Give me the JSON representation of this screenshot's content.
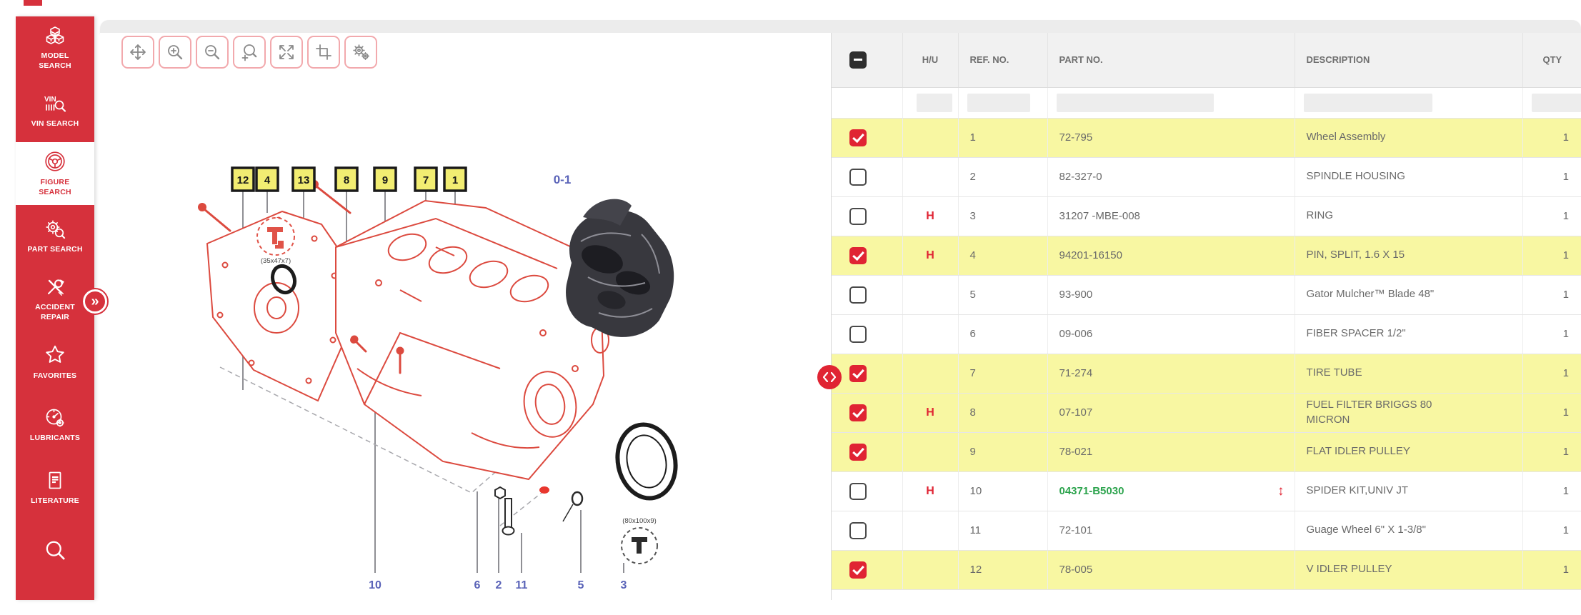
{
  "sidebar": {
    "items": [
      {
        "label": "MODEL\nSEARCH",
        "icon": "cubes-icon"
      },
      {
        "label": "VIN SEARCH",
        "icon": "vin-search-icon"
      },
      {
        "label": "FIGURE\nSEARCH",
        "icon": "steering-wheel-icon",
        "active": true
      },
      {
        "label": "PART SEARCH",
        "icon": "gear-magnifier-icon"
      },
      {
        "label": "ACCIDENT\nREPAIR",
        "icon": "tools-icon"
      },
      {
        "label": "FAVORITES",
        "icon": "star-icon"
      },
      {
        "label": "LUBRICANTS",
        "icon": "oil-gauge-icon"
      },
      {
        "label": "LITERATURE",
        "icon": "document-icon"
      },
      {
        "label": "",
        "icon": "magnifier-icon"
      }
    ],
    "expand_badge": "»"
  },
  "toolbar": {
    "buttons": [
      "pan",
      "zoom-in",
      "zoom-out",
      "zoom-selection",
      "fit-screen",
      "crop",
      "settings"
    ]
  },
  "figure": {
    "label": "0-1",
    "callouts": [
      "12",
      "4",
      "13",
      "8",
      "9",
      "7",
      "1"
    ],
    "bottom_labels": [
      "10",
      "6",
      "2",
      "11",
      "5",
      "3"
    ],
    "seal_note_1": "(35x47x7)",
    "seal_note_2": "(80x100x9)"
  },
  "table": {
    "columns": {
      "select": "",
      "hu": "H/U",
      "ref": "REF. NO.",
      "part": "PART NO.",
      "desc": "DESCRIPTION",
      "qty": "QTY"
    },
    "select_all_state": "indeterminate",
    "swap_icon_glyph": "↕",
    "rows": [
      {
        "selected": true,
        "hu": "",
        "ref": "1",
        "part": "72-795",
        "desc": "Wheel Assembly",
        "qty": "1"
      },
      {
        "selected": false,
        "hu": "",
        "ref": "2",
        "part": "82-327-0",
        "desc": "SPINDLE HOUSING",
        "qty": "1"
      },
      {
        "selected": false,
        "hu": "H",
        "ref": "3",
        "part": "31207 -MBE-008",
        "desc": "RING",
        "qty": "1"
      },
      {
        "selected": true,
        "hu": "H",
        "ref": "4",
        "part": "94201-16150",
        "desc": "PIN, SPLIT, 1.6 X 15",
        "qty": "1"
      },
      {
        "selected": false,
        "hu": "",
        "ref": "5",
        "part": "93-900",
        "desc": "Gator Mulcher™ Blade 48\"",
        "qty": "1"
      },
      {
        "selected": false,
        "hu": "",
        "ref": "6",
        "part": "09-006",
        "desc": "FIBER SPACER 1/2\"",
        "qty": "1"
      },
      {
        "selected": true,
        "hu": "",
        "ref": "7",
        "part": "71-274",
        "desc": "TIRE TUBE",
        "qty": "1"
      },
      {
        "selected": true,
        "hu": "H",
        "ref": "8",
        "part": "07-107",
        "desc": "FUEL FILTER BRIGGS 80 MICRON",
        "qty": "1"
      },
      {
        "selected": true,
        "hu": "",
        "ref": "9",
        "part": "78-021",
        "desc": "FLAT IDLER PULLEY",
        "qty": "1"
      },
      {
        "selected": false,
        "hu": "H",
        "ref": "10",
        "part": "04371-B5030",
        "desc": "SPIDER KIT,UNIV JT",
        "qty": "1",
        "part_link": true,
        "swap": true
      },
      {
        "selected": false,
        "hu": "",
        "ref": "11",
        "part": "72-101",
        "desc": "Guage Wheel 6\" X 1-3/8\"",
        "qty": "1"
      },
      {
        "selected": true,
        "hu": "",
        "ref": "12",
        "part": "78-005",
        "desc": "V IDLER PULLEY",
        "qty": "1"
      }
    ]
  },
  "colors": {
    "accent_red": "#d6313c",
    "checkbox_red": "#e02433",
    "row_highlight": "#f8f7a2",
    "callout_yellow": "#f2ed72",
    "figure_label_blue": "#5a63b8",
    "part_link_green": "#2da44e"
  }
}
